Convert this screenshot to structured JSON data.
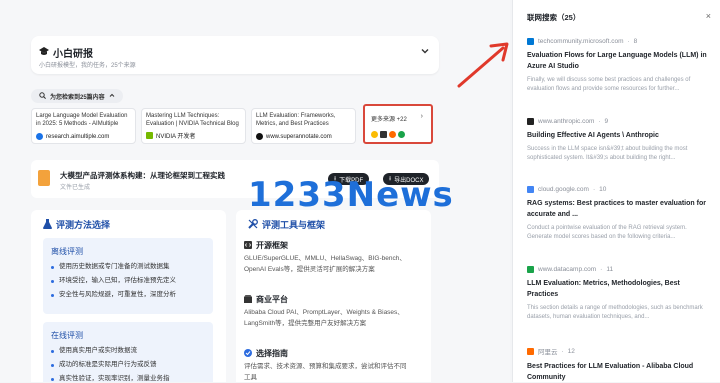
{
  "research": {
    "title": "小白研报",
    "subtitle": "小白研报模型，我的任务，25个来源",
    "collapse_icon": "chevron-down-icon"
  },
  "searched": {
    "label": "为您检索到25篇内容",
    "icon": "chevron-up-icon"
  },
  "sources": [
    {
      "title": "Large Language Model Evaluation in 2025: 5 Methods - AIMultiple",
      "domain": "research.aimultiple.com",
      "color": "#1a73e8"
    },
    {
      "title": "Mastering LLM Techniques: Evaluation | NVIDIA Technical Blog",
      "domain": "NVIDIA 开发者",
      "color": "#76b900"
    },
    {
      "title": "LLM Evaluation: Frameworks, Metrics, and Best Practices",
      "domain": "www.superannotate.com",
      "color": "#111111"
    }
  ],
  "more_sources": {
    "label": "更多来源 +22",
    "arrow": "›"
  },
  "doc": {
    "title": "大模型产品评测体系构建：从理论框架到工程实践",
    "subtitle": "文件已生成",
    "btn1": "下载PDF",
    "btn2": "导出DOCX"
  },
  "watermark": "1233News",
  "left_panel": {
    "title": "评测方法选择",
    "offline": {
      "title": "离线评测",
      "items": [
        "使用历史数据或专门准备的测试数据集",
        "环境受控，输入已知，评估标准预先定义",
        "安全性与风险规避，可重复性，深度分析"
      ]
    },
    "online": {
      "title": "在线评测",
      "items": [
        "使用真实用户或实时数据流",
        "成功的标准是实际用户行为或反馈",
        "真实性验证，实现率识别，测量业务指"
      ]
    }
  },
  "right_panel": {
    "title": "评测工具与框架",
    "sections": [
      {
        "title": "开源框架",
        "text": "GLUE/SuperGLUE、MMLU、HellaSwag、BIG-bench、OpenAI Evals等，提供灵活可扩展的解决方案"
      },
      {
        "title": "商业平台",
        "text": "Alibaba Cloud PAI、PromptLayer、Weights & Biases、LangSmith等，提供完整用户友好解决方案"
      },
      {
        "title": "选择指南",
        "text": "评估需求、技术资源、预算和集成要求，尝试和评估不同工具"
      }
    ]
  },
  "side": {
    "title": "联网搜索（25）",
    "close_icon": "×",
    "results": [
      {
        "domain": "techcommunity.microsoft.com",
        "index": "8",
        "title": "Evaluation Flows for Large Language Models (LLM) in Azure AI Studio",
        "snippet": "Finally, we will discuss some best practices and challenges of evaluation flows and provide some resources for further...",
        "color": "#0078d4"
      },
      {
        "domain": "www.anthropic.com",
        "index": "9",
        "title": "Building Effective AI Agents \\ Anthropic",
        "snippet": "Success in the LLM space isn&#39;t about building the most sophisticated system. It&#39;s about building the right...",
        "color": "#222222"
      },
      {
        "domain": "cloud.google.com",
        "index": "10",
        "title": "RAG systems: Best practices to master evaluation for accurate and ...",
        "snippet": "Conduct a pointwise evaluation of the RAG retrieval system. Generate model scores based on the following criteria...",
        "color": "#4285f4"
      },
      {
        "domain": "www.datacamp.com",
        "index": "11",
        "title": "LLM Evaluation: Metrics, Methodologies, Best Practices",
        "snippet": "This section details a range of methodologies, such as benchmark datasets, human evaluation techniques, and...",
        "color": "#03ef62"
      },
      {
        "domain": "阿里云",
        "index": "12",
        "title": "Best Practices for LLM Evaluation - Alibaba Cloud Community",
        "snippet": "",
        "color": "#ff6a00"
      }
    ]
  }
}
